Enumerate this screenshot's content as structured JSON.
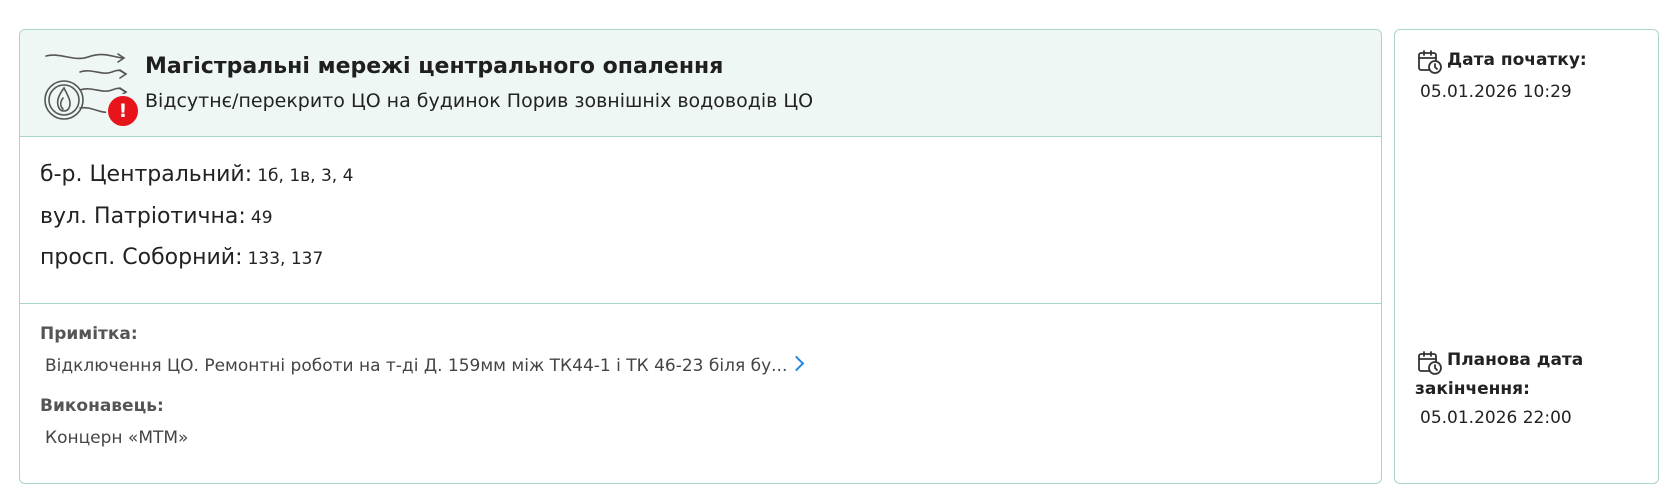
{
  "header": {
    "title": "Магістральні мережі центрального опалення",
    "subtitle": "Відсутнє/перекрито ЦО на будинок Порив зовнішніх водоводів ЦО",
    "icon": "district-heating-icon",
    "alert_icon": "alert-icon",
    "alert_symbol": "!"
  },
  "addresses": [
    {
      "street": "б-р. Центральний:",
      "houses": "1б, 1в, 3, 4"
    },
    {
      "street": "вул. Патріотична:",
      "houses": "49"
    },
    {
      "street": "просп. Соборний:",
      "houses": "133, 137"
    }
  ],
  "note": {
    "label": "Примітка:",
    "text": "Відключення ЦО. Ремонтні роботи на т-ді Д. 159мм між ТК44-1 і ТК 46-23 біля бу...",
    "more_icon": "chevron-right-icon"
  },
  "contractor": {
    "label": "Виконавець:",
    "value": "Концерн «МТМ»"
  },
  "dates": {
    "start_label": "Дата початку:",
    "start_value": "05.01.2026 10:29",
    "end_label": "Планова дата закінчення:",
    "end_value": "05.01.2026 22:00",
    "icon": "calendar-clock-icon"
  },
  "colors": {
    "border": "#a8d5c8",
    "header_bg": "#eef7f4",
    "alert": "#e8141c",
    "link": "#1e88e5"
  }
}
